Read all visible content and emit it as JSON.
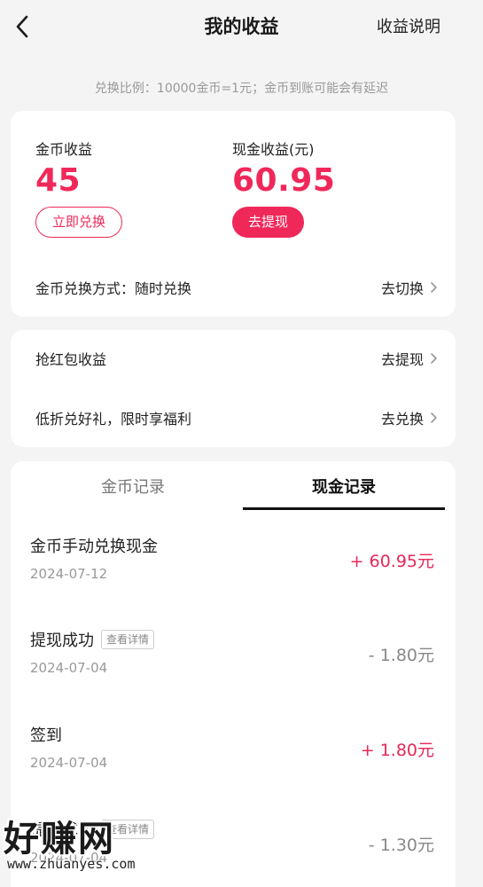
{
  "header": {
    "title": "我的收益",
    "explain_link": "收益说明"
  },
  "rate_notice": "兑换比例：10000金币=1元；金币到账可能会有延迟",
  "balances": {
    "coin": {
      "label": "金币收益",
      "value": "45",
      "button": "立即兑换"
    },
    "cash": {
      "label": "现金收益(元)",
      "value": "60.95",
      "button": "去提现"
    }
  },
  "exchange_mode": {
    "label": "金币兑换方式：随时兑换",
    "action": "去切换"
  },
  "links": [
    {
      "label": "抢红包收益",
      "action": "去提现"
    },
    {
      "label": "低折兑好礼，限时享福利",
      "action": "去兑换"
    }
  ],
  "tabs": [
    {
      "label": "金币记录",
      "active": false
    },
    {
      "label": "现金记录",
      "active": true
    }
  ],
  "records": [
    {
      "title": "金币手动兑换现金",
      "date": "2024-07-12",
      "amount": "+ 60.95元",
      "type": "plus"
    },
    {
      "title": "提现成功",
      "tag": "查看详情",
      "date": "2024-07-04",
      "amount": "- 1.80元",
      "type": "minus"
    },
    {
      "title": "签到",
      "date": "2024-07-04",
      "amount": "+ 1.80元",
      "type": "plus"
    },
    {
      "title": "提现成功",
      "tag": "查看详情",
      "date": "2024-07-04",
      "amount": "- 1.30元",
      "type": "minus"
    }
  ],
  "watermark": {
    "title": "好赚网",
    "url": "www.zhuanyes.com"
  },
  "colors": {
    "accent": "#f0285a",
    "plus": "#e6285a",
    "minus": "#888888"
  },
  "icons": {
    "back": "chevron-left-icon",
    "chevron": "chevron-right-icon"
  }
}
